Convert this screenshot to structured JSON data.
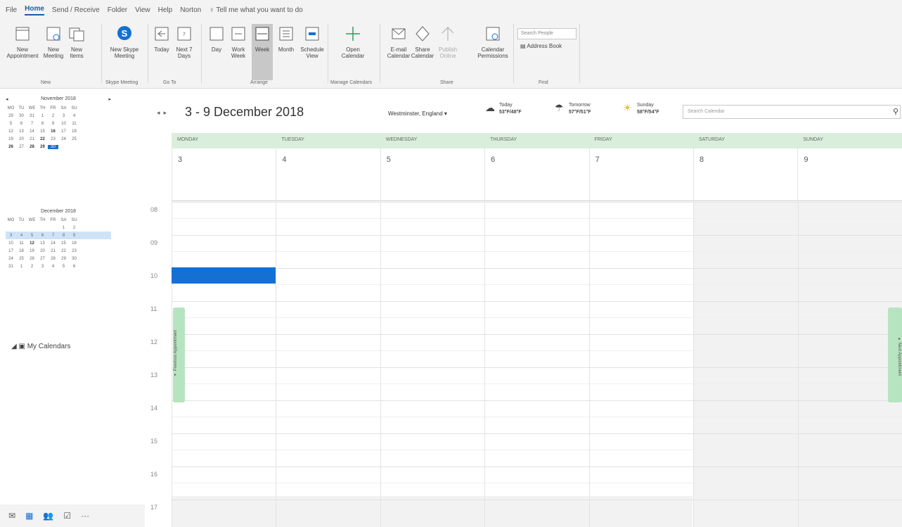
{
  "menu": {
    "items": [
      "File",
      "Home",
      "Send / Receive",
      "Folder",
      "View",
      "Help",
      "Norton"
    ],
    "active": "Home",
    "tell_me": "Tell me what you want to do"
  },
  "ribbon": {
    "buttons": {
      "new_appointment": "New Appointment",
      "new_meeting": "New Meeting",
      "new_items": "New Items",
      "new_skype_meeting": "New Skype Meeting",
      "today": "Today",
      "next7": "Next 7 Days",
      "day": "Day",
      "work_week": "Work Week",
      "week": "Week",
      "month": "Month",
      "schedule_view": "Schedule View",
      "open_calendar": "Open Calendar",
      "email_calendar": "E-mail Calendar",
      "share_calendar": "Share Calendar",
      "publish_online": "Publish Online",
      "calendar_permissions": "Calendar Permissions"
    },
    "groups": {
      "new": "New",
      "skype": "Skype Meeting",
      "goto": "Go To",
      "arrange": "Arrange",
      "manage": "Manage Calendars",
      "share": "Share",
      "find": "Find"
    },
    "search_people_placeholder": "Search People",
    "address_book": "Address Book"
  },
  "minical_nov": {
    "title": "November 2018",
    "days": [
      "MO",
      "TU",
      "WE",
      "TH",
      "FR",
      "SA",
      "SU"
    ],
    "weeks": [
      [
        "29",
        "30",
        "31",
        "1",
        "2",
        "3",
        "4"
      ],
      [
        "5",
        "6",
        "7",
        "8",
        "9",
        "10",
        "11"
      ],
      [
        "12",
        "13",
        "14",
        "15",
        "16",
        "17",
        "18"
      ],
      [
        "19",
        "20",
        "21",
        "22",
        "23",
        "24",
        "25"
      ],
      [
        "26",
        "27",
        "28",
        "29",
        "30",
        "",
        ""
      ]
    ]
  },
  "minical_dec": {
    "title": "December 2018",
    "days": [
      "MO",
      "TU",
      "WE",
      "TH",
      "FR",
      "SA",
      "SU"
    ],
    "weeks": [
      [
        "",
        "",
        "",
        "",
        "",
        "1",
        "2"
      ],
      [
        "3",
        "4",
        "5",
        "6",
        "7",
        "8",
        "9"
      ],
      [
        "10",
        "11",
        "12",
        "13",
        "14",
        "15",
        "16"
      ],
      [
        "17",
        "18",
        "19",
        "20",
        "21",
        "22",
        "23"
      ],
      [
        "24",
        "25",
        "26",
        "27",
        "28",
        "29",
        "30"
      ],
      [
        "31",
        "1",
        "2",
        "3",
        "4",
        "5",
        "6"
      ]
    ]
  },
  "my_calendars": "My Calendars",
  "main": {
    "date_range": "3 - 9 December 2018",
    "location": "Westminster, England",
    "weather": [
      {
        "label": "Today",
        "temp": "53°F/48°F"
      },
      {
        "label": "Tomorrow",
        "temp": "57°F/51°F"
      },
      {
        "label": "Sunday",
        "temp": "58°F/54°F"
      }
    ],
    "search_placeholder": "Search Calendar",
    "days": [
      "MONDAY",
      "TUESDAY",
      "WEDNESDAY",
      "THURSDAY",
      "FRIDAY",
      "SATURDAY",
      "SUNDAY"
    ],
    "dates": [
      "3",
      "4",
      "5",
      "6",
      "7",
      "8",
      "9"
    ],
    "hours": [
      "08",
      "09",
      "10",
      "11",
      "12",
      "13",
      "14",
      "15",
      "16",
      "17"
    ],
    "prev_tab": "Previous Appointment",
    "next_tab": "Next Appointment"
  },
  "colors": {
    "accent": "#1570d4",
    "header_green": "#d9efdc",
    "tab_green": "#b7e4c0"
  }
}
